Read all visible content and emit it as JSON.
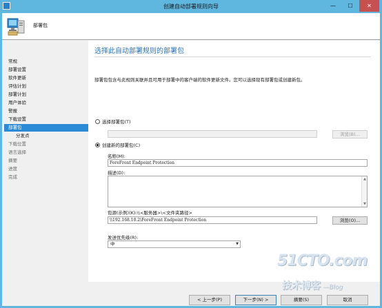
{
  "window": {
    "title": "创建自动部署规则向导",
    "min_glyph": "—",
    "max_glyph": "☐",
    "close_glyph": "✕"
  },
  "header": {
    "title": "部署包",
    "icon": "computer-package-icon"
  },
  "nav": {
    "items": [
      {
        "label": "常规",
        "state": "done"
      },
      {
        "label": "部署设置",
        "state": "done"
      },
      {
        "label": "软件更新",
        "state": "done"
      },
      {
        "label": "评估计划",
        "state": "done"
      },
      {
        "label": "部署计划",
        "state": "done"
      },
      {
        "label": "用户体验",
        "state": "done"
      },
      {
        "label": "警报",
        "state": "done"
      },
      {
        "label": "下载设置",
        "state": "done"
      },
      {
        "label": "部署包",
        "state": "active"
      },
      {
        "label": "分发点",
        "state": "sub"
      },
      {
        "label": "下载位置",
        "state": "future"
      },
      {
        "label": "语言选择",
        "state": "future"
      },
      {
        "label": "摘要",
        "state": "future"
      },
      {
        "label": "进度",
        "state": "future"
      },
      {
        "label": "完成",
        "state": "future"
      }
    ]
  },
  "main": {
    "title": "选择此自动部署规则的部署包",
    "description": "部署包包含与此规则关联并且可用于部署中的客户端的软件更新文件。您可以选择现有部署包或创建新包。",
    "select_existing": {
      "label": "选择部署包(T)",
      "checked": false,
      "value": "",
      "browse_label": "浏览(B)..."
    },
    "create_new": {
      "label": "创建新的部署包(C)",
      "checked": true
    },
    "name": {
      "label": "名称(M):",
      "value": "ForeFront Endpoint Protection"
    },
    "description_field": {
      "label": "描述(D):",
      "value": ""
    },
    "source": {
      "label": "包源(示例)(K):\\\\<服务器>\\<文件夹路径>",
      "value": "\\\\192.168.10.2\\ForeFront Endpoint Protection",
      "browse_label": "浏览(O)..."
    },
    "priority": {
      "label": "发送优先级(R):",
      "value": "中"
    }
  },
  "footer": {
    "back_label": "< 上一步(P)",
    "next_label": "下一步(N) >",
    "summary_label": "摘要(S)",
    "cancel_label": "取消"
  },
  "watermark": {
    "line1": "51CTO.com",
    "line2": "技术博客",
    "blog": "Blog"
  }
}
